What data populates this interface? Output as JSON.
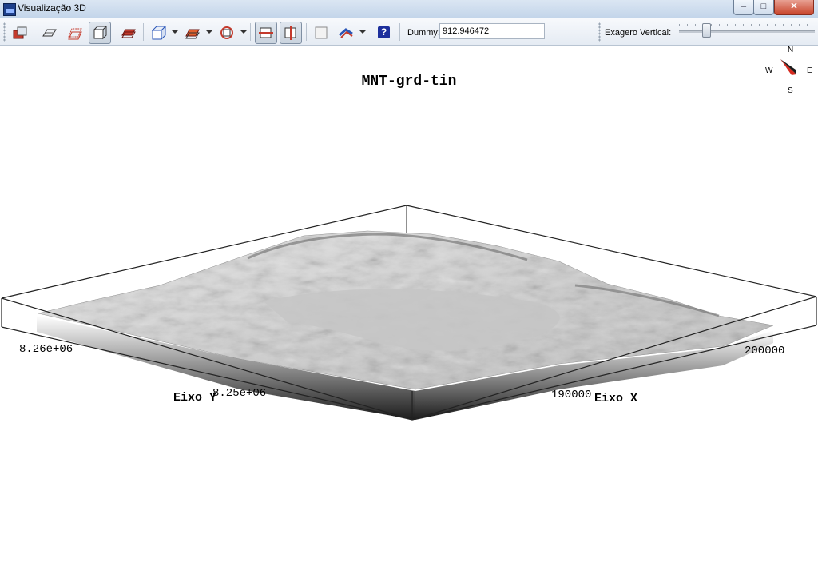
{
  "window": {
    "title": "Visualização 3D",
    "controls": {
      "minimize": "–",
      "maximize": "□",
      "close": "✕"
    }
  },
  "toolbar": {
    "dummy_label": "Dummy:",
    "dummy_value": "912.946472",
    "exaggeration_label": "Exagero Vertical:",
    "exaggeration_level": 0.2,
    "help_label": "?"
  },
  "plot": {
    "title": "MNT-grd-tin",
    "x_axis_title": "Eixo X",
    "y_axis_title": "Eixo Y",
    "x_ticks": [
      "190000",
      "200000"
    ],
    "y_ticks": [
      "8.26e+06",
      "8.25e+06"
    ]
  },
  "compass": {
    "north": "N",
    "south": "S",
    "east": "E",
    "west": "W"
  },
  "colors": {
    "accent": "#1d3f8a",
    "needle": "#d62a1f"
  }
}
